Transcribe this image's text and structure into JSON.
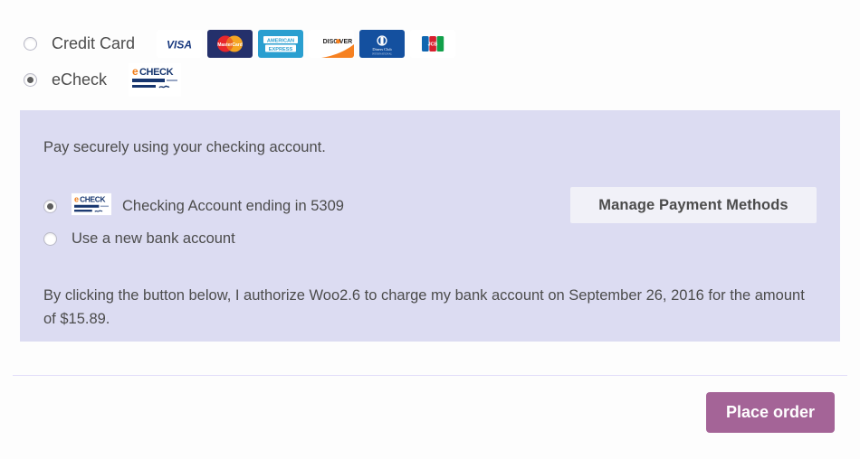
{
  "payment_methods": [
    {
      "id": "credit-card",
      "label": "Credit Card",
      "selected": false,
      "icons": [
        {
          "name": "visa-card-icon",
          "label": "VISA"
        },
        {
          "name": "mastercard-card-icon",
          "label": "MasterCard"
        },
        {
          "name": "amex-card-icon",
          "label": "AMERICAN EXPRESS"
        },
        {
          "name": "discover-card-icon",
          "label": "DISCOVER"
        },
        {
          "name": "diners-club-card-icon",
          "label": "Diners Club INTERNATIONAL"
        },
        {
          "name": "jcb-card-icon",
          "label": "JCB"
        }
      ]
    },
    {
      "id": "echeck",
      "label": "eCheck",
      "selected": true,
      "icons": [
        {
          "name": "echeck-icon",
          "label": "eCHECK"
        }
      ]
    }
  ],
  "echeck_panel": {
    "intro": "Pay securely using your checking account.",
    "tokens": [
      {
        "id": "saved-account",
        "label": "Checking Account ending in 5309",
        "selected": true,
        "icon": "echeck-icon"
      },
      {
        "id": "new-account",
        "label": "Use a new bank account",
        "selected": false,
        "icon": null
      }
    ],
    "manage_button": "Manage Payment Methods",
    "authorization": "By clicking the button below, I authorize Woo2.6 to charge my bank account on September 26, 2016 for the amount of $15.89.",
    "merchant": "Woo2.6",
    "charge_date": "September 26, 2016",
    "amount": "$15.89",
    "background_color": "#dcdcf2"
  },
  "footer": {
    "place_order_label": "Place order",
    "place_order_color": "#a46497"
  },
  "echeck_logo_text": {
    "e": "e",
    "check": "CHECK"
  }
}
